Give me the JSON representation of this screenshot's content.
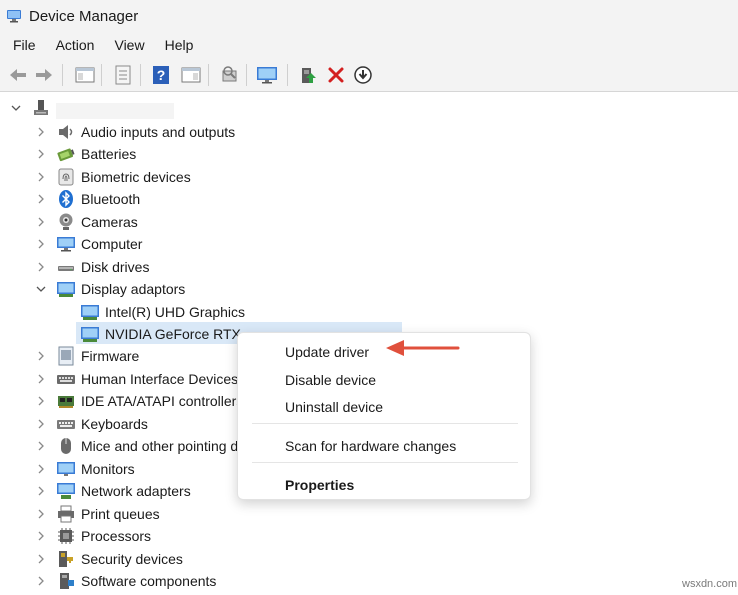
{
  "window": {
    "title": "Device Manager",
    "icon": "computer-management-icon"
  },
  "menu": [
    {
      "key": "file",
      "label": "File"
    },
    {
      "key": "action",
      "label": "Action"
    },
    {
      "key": "view",
      "label": "View"
    },
    {
      "key": "help",
      "label": "Help"
    }
  ],
  "toolbar": [
    {
      "name": "back-icon"
    },
    {
      "name": "forward-icon"
    },
    {
      "name": "show-hide-console-tree-icon"
    },
    {
      "name": "properties-icon"
    },
    {
      "name": "help-icon"
    },
    {
      "name": "action-pane-icon"
    },
    {
      "name": "scan-hardware-changes-icon"
    },
    {
      "name": "monitor-icon"
    },
    {
      "name": "update-driver-icon"
    },
    {
      "name": "uninstall-icon"
    },
    {
      "name": "download-icon"
    }
  ],
  "tree": {
    "root_icon": "computer-icon",
    "categories": [
      {
        "key": "audio",
        "label": "Audio inputs and outputs",
        "icon": "speaker-icon"
      },
      {
        "key": "batteries",
        "label": "Batteries",
        "icon": "battery-icon"
      },
      {
        "key": "biometric",
        "label": "Biometric devices",
        "icon": "fingerprint-icon"
      },
      {
        "key": "bluetooth",
        "label": "Bluetooth",
        "icon": "bluetooth-icon"
      },
      {
        "key": "cameras",
        "label": "Cameras",
        "icon": "camera-icon"
      },
      {
        "key": "computer",
        "label": "Computer",
        "icon": "computer-icon"
      },
      {
        "key": "disk",
        "label": "Disk drives",
        "icon": "disk-drive-icon"
      },
      {
        "key": "display",
        "label": "Display adaptors",
        "icon": "display-adapter-icon",
        "expanded": true
      },
      {
        "key": "intel",
        "label": "Intel(R) UHD Graphics",
        "icon": "display-adapter-icon",
        "child": true
      },
      {
        "key": "nvidia",
        "label": "NVIDIA GeForce RTX",
        "icon": "display-adapter-icon",
        "child": true,
        "selected": true
      },
      {
        "key": "firmware",
        "label": "Firmware",
        "icon": "firmware-icon"
      },
      {
        "key": "hid",
        "label": "Human Interface Devices",
        "icon": "hid-icon"
      },
      {
        "key": "ide",
        "label": "IDE ATA/ATAPI controllers",
        "icon": "ide-controller-icon"
      },
      {
        "key": "keyboards",
        "label": "Keyboards",
        "icon": "keyboard-icon"
      },
      {
        "key": "mice",
        "label": "Mice and other pointing devices",
        "icon": "mouse-icon"
      },
      {
        "key": "monitors",
        "label": "Monitors",
        "icon": "monitor-icon"
      },
      {
        "key": "network",
        "label": "Network adapters",
        "icon": "network-adapter-icon"
      },
      {
        "key": "print",
        "label": "Print queues",
        "icon": "printer-icon"
      },
      {
        "key": "processors",
        "label": "Processors",
        "icon": "processor-icon"
      },
      {
        "key": "security",
        "label": "Security devices",
        "icon": "security-device-icon"
      },
      {
        "key": "software",
        "label": "Software components",
        "icon": "software-component-icon"
      }
    ]
  },
  "context_menu": {
    "items": [
      {
        "key": "update",
        "label": "Update driver"
      },
      {
        "key": "disable",
        "label": "Disable device"
      },
      {
        "key": "uninstall",
        "label": "Uninstall device"
      },
      {
        "key": "scan",
        "label": "Scan for hardware changes"
      },
      {
        "key": "properties",
        "label": "Properties"
      }
    ]
  },
  "annotation": {
    "icon": "red-arrow-icon",
    "color": "#e0503c"
  },
  "watermark": "wsxdn.com",
  "colors": {
    "selection": "#d9e8f7",
    "chrome": "#f3f3f3"
  }
}
